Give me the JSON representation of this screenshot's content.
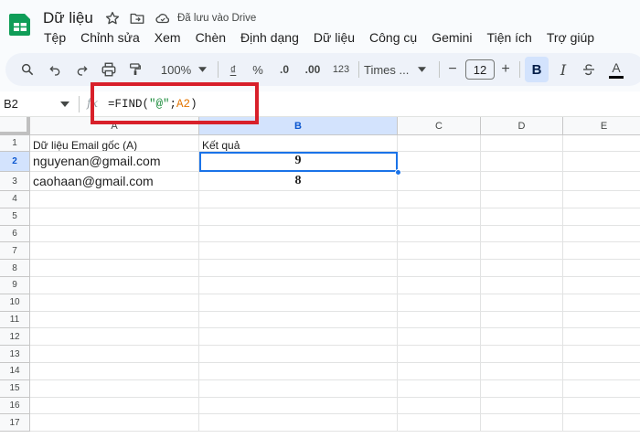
{
  "app": {
    "doc_title": "Dữ liệu",
    "save_status": "Đã lưu vào Drive",
    "colors": {
      "accent": "#1a73e8",
      "highlight": "#d8202a",
      "logo": "#0f9d58"
    }
  },
  "menu": [
    "Tệp",
    "Chỉnh sửa",
    "Xem",
    "Chèn",
    "Định dạng",
    "Dữ liệu",
    "Công cụ",
    "Gemini",
    "Tiện ích",
    "Trợ giúp"
  ],
  "toolbar": {
    "zoom": "100%",
    "currency": "₫",
    "percent": "%",
    "decrease_decimal": ".0",
    "increase_decimal": ".00",
    "number_format": "123",
    "font": "Times ...",
    "font_size": "12",
    "minus": "−",
    "plus": "+",
    "bold": "B",
    "italic": "I",
    "text_color": "A"
  },
  "formula_bar": {
    "cell_ref": "B2",
    "fx": "fx",
    "formula_prefix": "=FIND(",
    "formula_string": "\"@\"",
    "formula_sep": ";",
    "formula_ref": "A2",
    "formula_suffix": ")"
  },
  "sheet": {
    "columns": [
      "A",
      "B",
      "C",
      "D",
      "E"
    ],
    "rows": [
      "1",
      "2",
      "3",
      "4",
      "5",
      "6",
      "7",
      "8",
      "9",
      "10",
      "11",
      "12",
      "13",
      "14",
      "15",
      "16",
      "17"
    ],
    "selected_cell": "B2",
    "cells": {
      "A1": "Dữ liệu Email gốc (A)",
      "B1": "Kết quả",
      "A2": "nguyenan@gmail.com",
      "B2": "9",
      "A3": "caohaan@gmail.com",
      "B3": "8"
    }
  }
}
